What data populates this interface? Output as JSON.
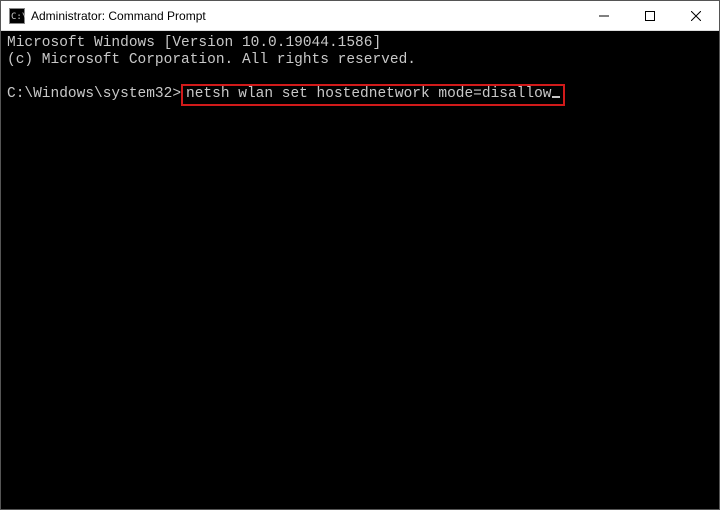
{
  "window": {
    "title": "Administrator: Command Prompt"
  },
  "terminal": {
    "line1": "Microsoft Windows [Version 10.0.19044.1586]",
    "line2": "(c) Microsoft Corporation. All rights reserved.",
    "prompt": "C:\\Windows\\system32>",
    "command": "netsh wlan set hostednetwork mode=disallow"
  }
}
